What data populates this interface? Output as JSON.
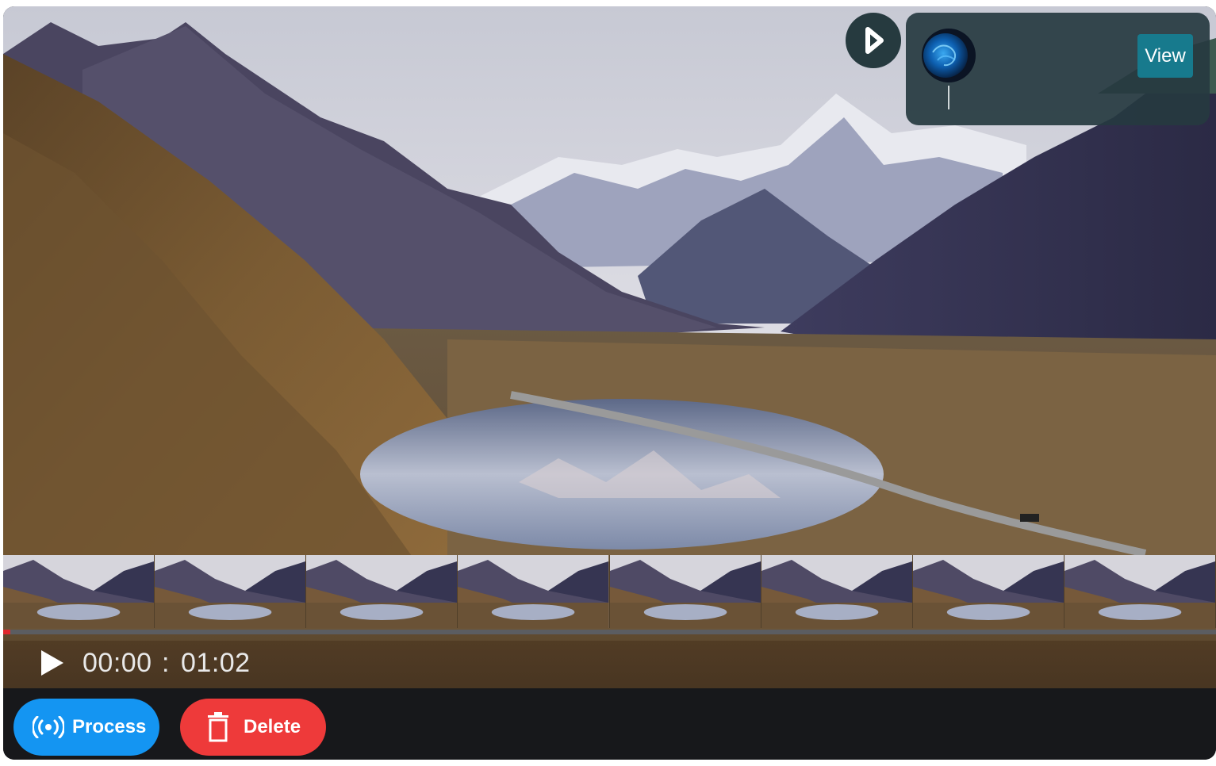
{
  "player": {
    "current_time": "00:00",
    "separator": ":",
    "total_time": "01:02",
    "progress": 0.006,
    "thumbnail_count": 8
  },
  "actions": {
    "process_label": "Process",
    "delete_label": "Delete",
    "process_icon": "broadcast-icon",
    "delete_icon": "trash-icon"
  },
  "queue": {
    "view_label": "View",
    "next_icon": "play-next-icon"
  },
  "colors": {
    "process": "#1495f2",
    "delete": "#ee3a3a",
    "progress_fill": "#e0282e",
    "view_button": "#177a8d",
    "queue_card": "#263a3f"
  }
}
